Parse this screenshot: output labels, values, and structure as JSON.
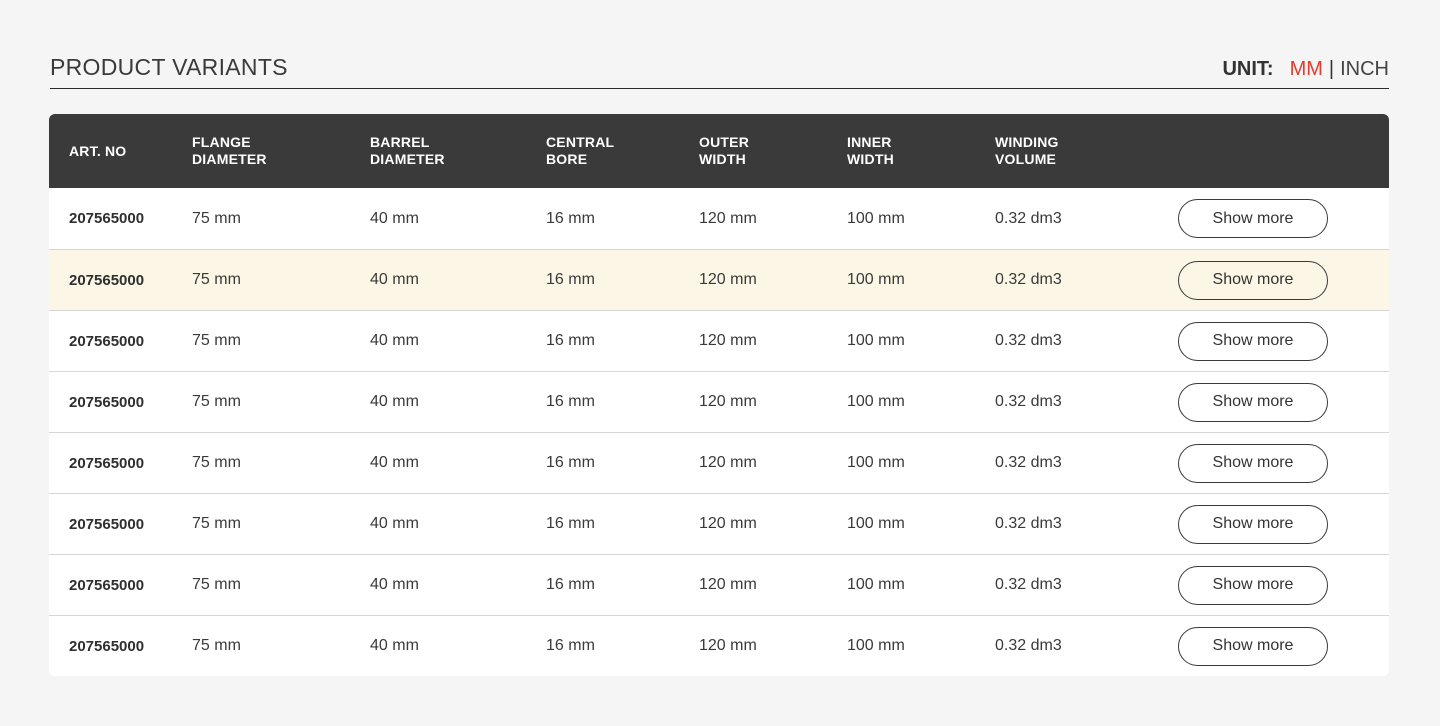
{
  "header": {
    "title": "PRODUCT VARIANTS",
    "unit_label": "UNIT:",
    "unit_options": [
      "MM",
      "INCH"
    ],
    "unit_separator": "|",
    "unit_selected": "MM",
    "accent_color": "#e53b2c"
  },
  "table": {
    "columns": [
      "ART. NO",
      "FLANGE\nDIAMETER",
      "BARREL\nDIAMETER",
      "CENTRAL\nBORE",
      "OUTER\nWIDTH",
      "INNER\nWIDTH",
      "WINDING\nVOLUME",
      ""
    ],
    "highlighted_row_index": 1,
    "highlight_color": "#fbf6e5",
    "header_bg_color": "#3a3a3a",
    "action_label": "Show more",
    "rows": [
      {
        "art_no": "207565000",
        "flange_diameter": "75 mm",
        "barrel_diameter": "40 mm",
        "central_bore": "16 mm",
        "outer_width": "120 mm",
        "inner_width": "100 mm",
        "winding_volume": "0.32 dm3"
      },
      {
        "art_no": "207565000",
        "flange_diameter": "75 mm",
        "barrel_diameter": "40 mm",
        "central_bore": "16 mm",
        "outer_width": "120 mm",
        "inner_width": "100 mm",
        "winding_volume": "0.32 dm3"
      },
      {
        "art_no": "207565000",
        "flange_diameter": "75 mm",
        "barrel_diameter": "40 mm",
        "central_bore": "16 mm",
        "outer_width": "120 mm",
        "inner_width": "100 mm",
        "winding_volume": "0.32 dm3"
      },
      {
        "art_no": "207565000",
        "flange_diameter": "75 mm",
        "barrel_diameter": "40 mm",
        "central_bore": "16 mm",
        "outer_width": "120 mm",
        "inner_width": "100 mm",
        "winding_volume": "0.32 dm3"
      },
      {
        "art_no": "207565000",
        "flange_diameter": "75 mm",
        "barrel_diameter": "40 mm",
        "central_bore": "16 mm",
        "outer_width": "120 mm",
        "inner_width": "100 mm",
        "winding_volume": "0.32 dm3"
      },
      {
        "art_no": "207565000",
        "flange_diameter": "75 mm",
        "barrel_diameter": "40 mm",
        "central_bore": "16 mm",
        "outer_width": "120 mm",
        "inner_width": "100 mm",
        "winding_volume": "0.32 dm3"
      },
      {
        "art_no": "207565000",
        "flange_diameter": "75 mm",
        "barrel_diameter": "40 mm",
        "central_bore": "16 mm",
        "outer_width": "120 mm",
        "inner_width": "100 mm",
        "winding_volume": "0.32 dm3"
      },
      {
        "art_no": "207565000",
        "flange_diameter": "75 mm",
        "barrel_diameter": "40 mm",
        "central_bore": "16 mm",
        "outer_width": "120 mm",
        "inner_width": "100 mm",
        "winding_volume": "0.32 dm3"
      }
    ]
  }
}
